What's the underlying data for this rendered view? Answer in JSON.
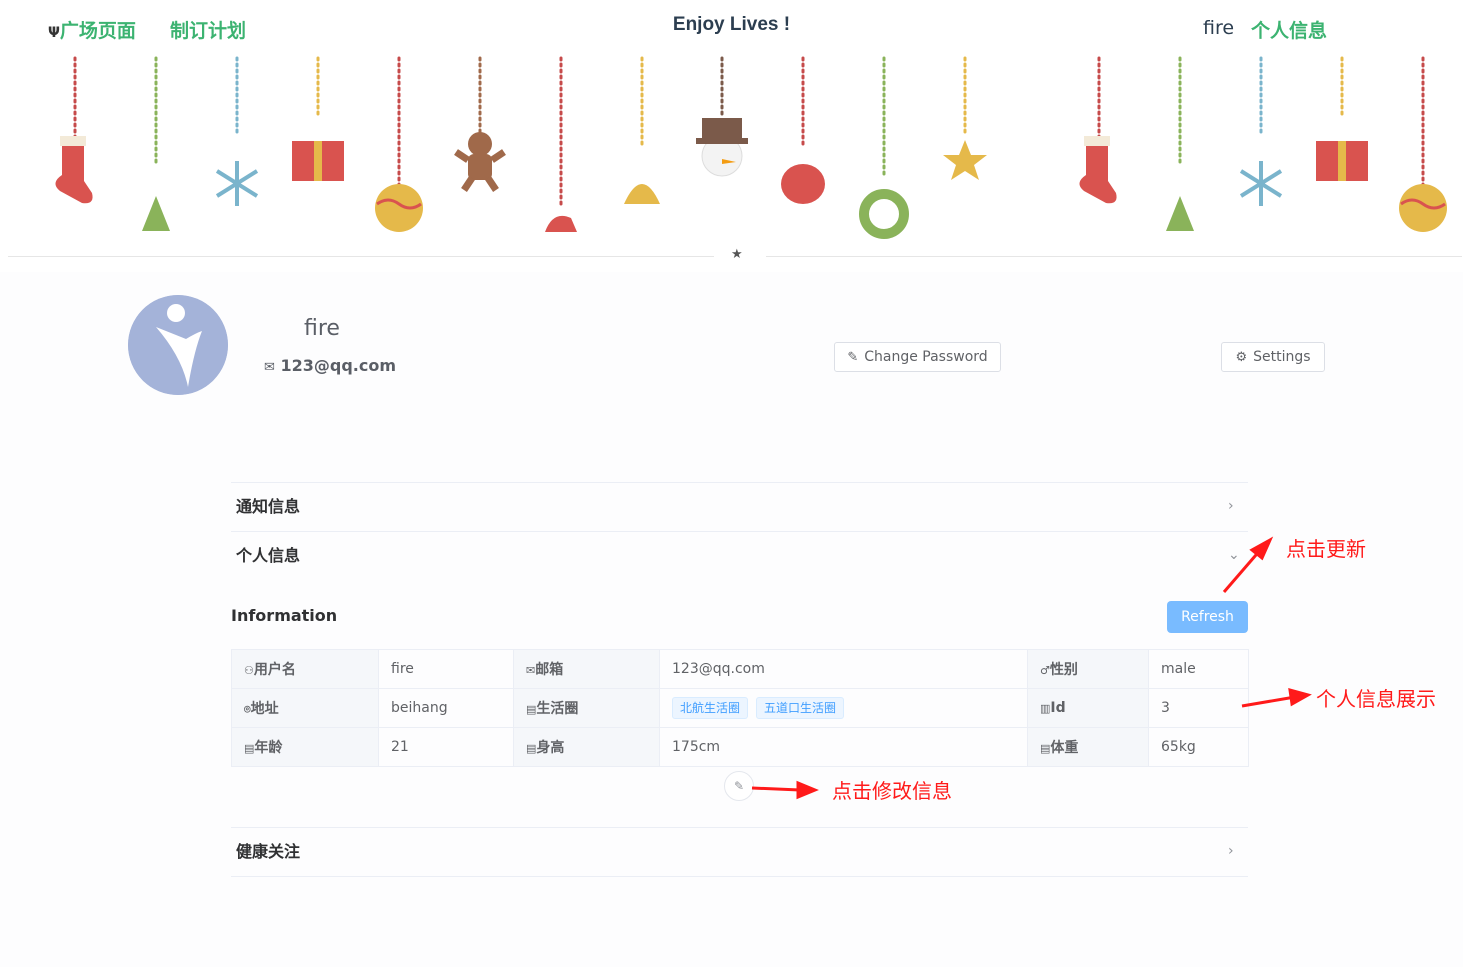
{
  "header": {
    "nav": [
      {
        "label": "广场页面",
        "icon": "fork-knife-icon"
      },
      {
        "label": "制订计划"
      }
    ],
    "title": "Enjoy Lives !",
    "username": "fire",
    "profile_link": "个人信息"
  },
  "profile": {
    "name": "fire",
    "email": "123@qq.com",
    "change_password": "Change Password",
    "settings": "Settings"
  },
  "panels": {
    "notice": "通知信息",
    "personal": "个人信息",
    "health": "健康关注"
  },
  "info": {
    "title": "Information",
    "refresh": "Refresh",
    "rows": [
      {
        "l1": "用户名",
        "v1": "fire",
        "l2": "邮箱",
        "v2": "123@qq.com",
        "l3": "性别",
        "v3": "male"
      },
      {
        "l1": "地址",
        "v1": "beihang",
        "l2": "生活圈",
        "tags": [
          "北航生活圈",
          "五道口生活圈"
        ],
        "l3": "Id",
        "v3": "3"
      },
      {
        "l1": "年龄",
        "v1": "21",
        "l2": "身高",
        "v2": "175cm",
        "l3": "体重",
        "v3": "65kg"
      }
    ]
  },
  "annotations": {
    "refresh": "点击更新",
    "display": "个人信息展示",
    "edit": "点击修改信息"
  },
  "colors": {
    "accent": "#3cb371",
    "primary_light": "#79bbff",
    "annotation": "#ff1a1a"
  }
}
